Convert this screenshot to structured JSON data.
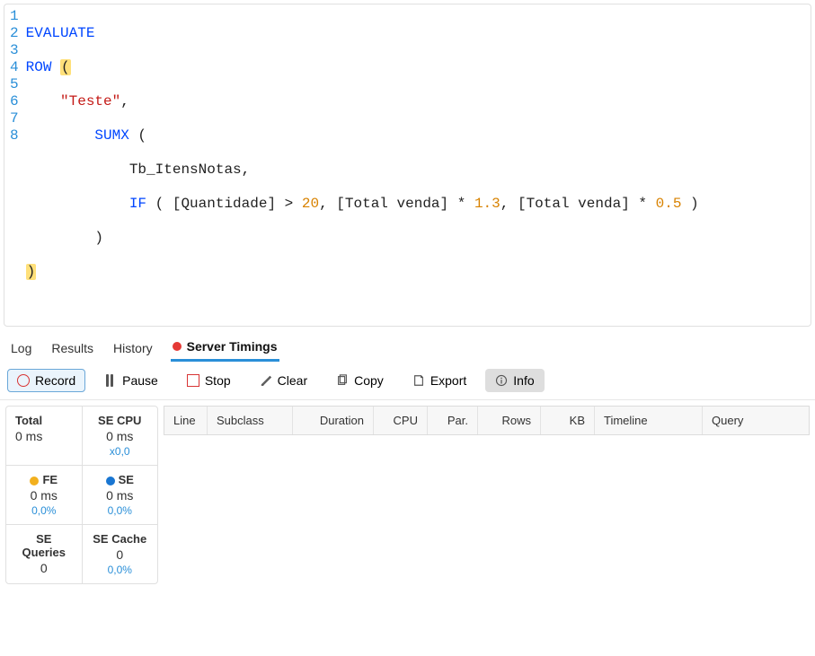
{
  "code": {
    "lines": [
      {
        "n": "1"
      },
      {
        "n": "2"
      },
      {
        "n": "3"
      },
      {
        "n": "4"
      },
      {
        "n": "5"
      },
      {
        "n": "6"
      },
      {
        "n": "7"
      },
      {
        "n": "8"
      }
    ],
    "t_evaluate": "EVALUATE",
    "t_row": "ROW",
    "t_paren_o": "(",
    "t_paren_c": ")",
    "t_teste": "\"Teste\"",
    "t_comma": ",",
    "t_sumx": "SUMX",
    "t_tb": "Tb_ItensNotas",
    "t_if": "IF",
    "t_col_quant": "[Quantidade]",
    "t_gt": ">",
    "t_20": "20",
    "t_col_total": "[Total venda]",
    "t_star": "*",
    "t_1_3": "1.3",
    "t_0_5": "0.5"
  },
  "tabs": {
    "log": "Log",
    "results": "Results",
    "history": "History",
    "server_timings": "Server Timings"
  },
  "toolbar": {
    "record": "Record",
    "pause": "Pause",
    "stop": "Stop",
    "clear": "Clear",
    "copy": "Copy",
    "export": "Export",
    "info": "Info"
  },
  "metrics": {
    "total_label": "Total",
    "total_val": "0 ms",
    "secpu_label": "SE CPU",
    "secpu_val": "0 ms",
    "secpu_small": "x0,0",
    "fe_label": "FE",
    "fe_val": "0 ms",
    "fe_small": "0,0%",
    "se_label": "SE",
    "se_val": "0 ms",
    "se_small": "0,0%",
    "seq_label": "SE Queries",
    "seq_val": "0",
    "secache_label": "SE Cache",
    "secache_val": "0",
    "secache_small": "0,0%"
  },
  "grid": {
    "line": "Line",
    "subclass": "Subclass",
    "duration": "Duration",
    "cpu": "CPU",
    "par": "Par.",
    "rows": "Rows",
    "kb": "KB",
    "timeline": "Timeline",
    "query": "Query"
  }
}
